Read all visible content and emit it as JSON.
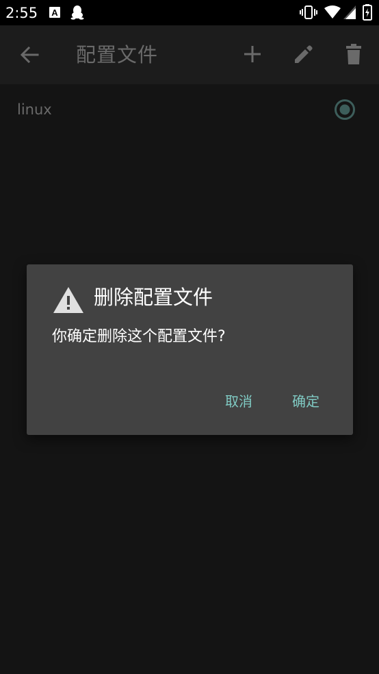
{
  "status_bar": {
    "time": "2:55",
    "icons": [
      "font-icon",
      "qq-icon",
      "vibrate-icon",
      "wifi-icon",
      "signal-icon",
      "battery-icon"
    ]
  },
  "app_bar": {
    "title": "配置文件",
    "icons": [
      "back-arrow-icon",
      "add-icon",
      "edit-pencil-icon",
      "delete-trash-icon"
    ]
  },
  "profiles": [
    {
      "label": "linux",
      "selected": true
    }
  ],
  "dialog": {
    "title": "删除配置文件",
    "message": "你确定删除这个配置文件?",
    "cancel_label": "取消",
    "confirm_label": "确定",
    "icon": "warning-icon"
  },
  "colors": {
    "background": "#141414",
    "status_bar": "#000000",
    "dialog_bg": "#424242",
    "accent": "#80cbc4",
    "dim_text": "#6a6a6a"
  }
}
